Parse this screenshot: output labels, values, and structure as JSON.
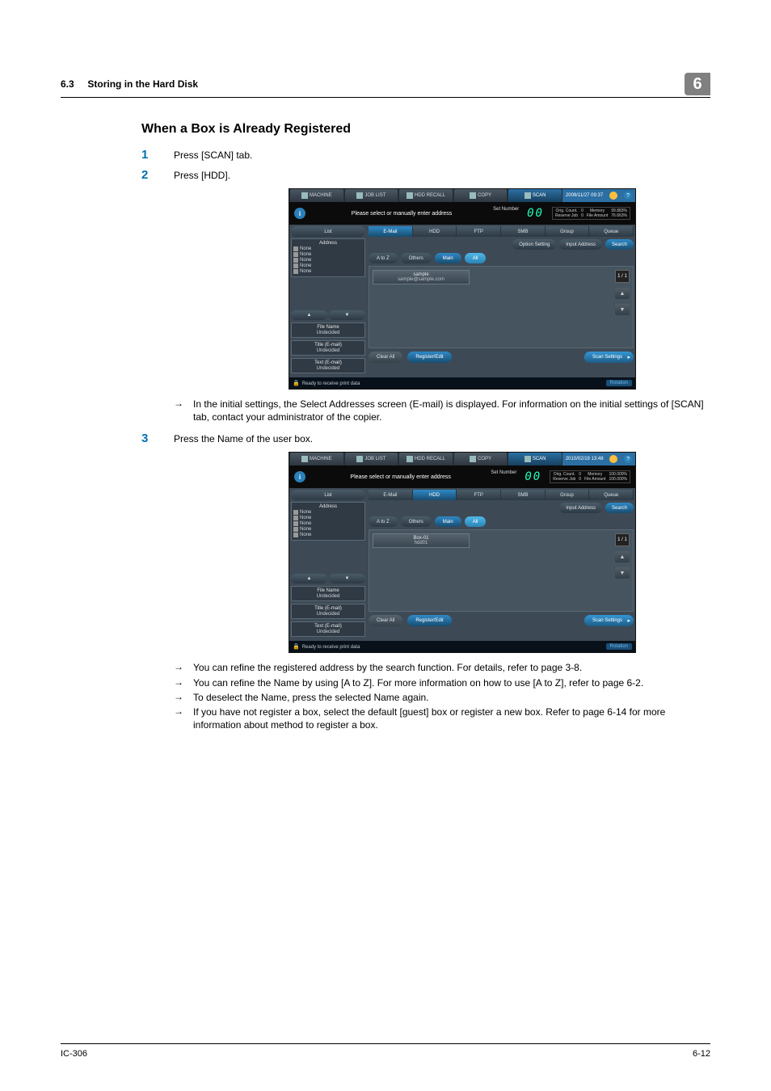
{
  "header": {
    "section_num": "6.3",
    "section_title": "Storing in the Hard Disk",
    "chapter_num": "6"
  },
  "title": "When a Box is Already Registered",
  "steps": {
    "s1": {
      "n": "1",
      "text": "Press [SCAN] tab."
    },
    "s2": {
      "n": "2",
      "text": "Press [HDD]."
    },
    "s3": {
      "n": "3",
      "text": "Press the Name of the user box."
    }
  },
  "arrow": "→",
  "note1": "In the initial settings, the Select Addresses screen (E-mail) is displayed.  For information on the initial settings of [SCAN] tab, contact your administrator of the copier.",
  "notes2": {
    "a": "You can refine the registered address by the search function. For details, refer to page 3-8.",
    "b": "You can refine the Name by using [A to Z]. For more information on how to use [A to Z], refer to page 6-2.",
    "c": "To deselect the Name, press the selected Name again.",
    "d": "If you have not register a box, select the default [guest] box or register a new box. Refer to page 6-14 for more information about method to register a box."
  },
  "footer": {
    "left": "IC-306",
    "right": "6-12"
  },
  "ui": {
    "tabs": {
      "machine": "MACHINE",
      "joblist": "JOB LIST",
      "hddrecall": "HDD RECALL",
      "copy": "COPY",
      "scan": "SCAN"
    },
    "time1": "2009/11/27 09:37",
    "time2": "2010/02/19 13:48",
    "info": "Please select or manually enter address",
    "setnum": "Set Number",
    "zeros": "00",
    "counts1": {
      "oc": "Orig. Count.",
      "ocv": "0",
      "mem": "Memory",
      "memv": "99.883%",
      "rj": "Reserve Job",
      "rjv": "0",
      "fa": "File Amount",
      "fav": "76.663%"
    },
    "counts2": {
      "memv": "100.000%",
      "fav": "100.000%"
    },
    "list": "List",
    "address": "Address",
    "none": "None",
    "filename": "File Name",
    "undecided": "Undecided",
    "titleemail": "Title (E-mail)",
    "textemail": "Text (E-mail)",
    "up": "▲",
    "down": "▼",
    "tabs2": {
      "email": "E-Mail",
      "hdd": "HDD",
      "ftp": "FTP",
      "smb": "SMB",
      "group": "Group",
      "queue": "Queue"
    },
    "opt": "Option Setting",
    "inaddr": "Input Address",
    "search": "Search",
    "atoz": "A to Z",
    "others": "Others",
    "main": "Main",
    "all": "All",
    "cell1": {
      "a": "sample",
      "b": "sample@sample.com"
    },
    "cell2": {
      "a": "Box-01",
      "b": "hdd01"
    },
    "pgn": "1 / 1",
    "clear": "Clear All",
    "regedit": "Register/Edit",
    "scanset": "Scan Settings",
    "status": "Ready to receive print data",
    "rotation": "Rotation"
  }
}
